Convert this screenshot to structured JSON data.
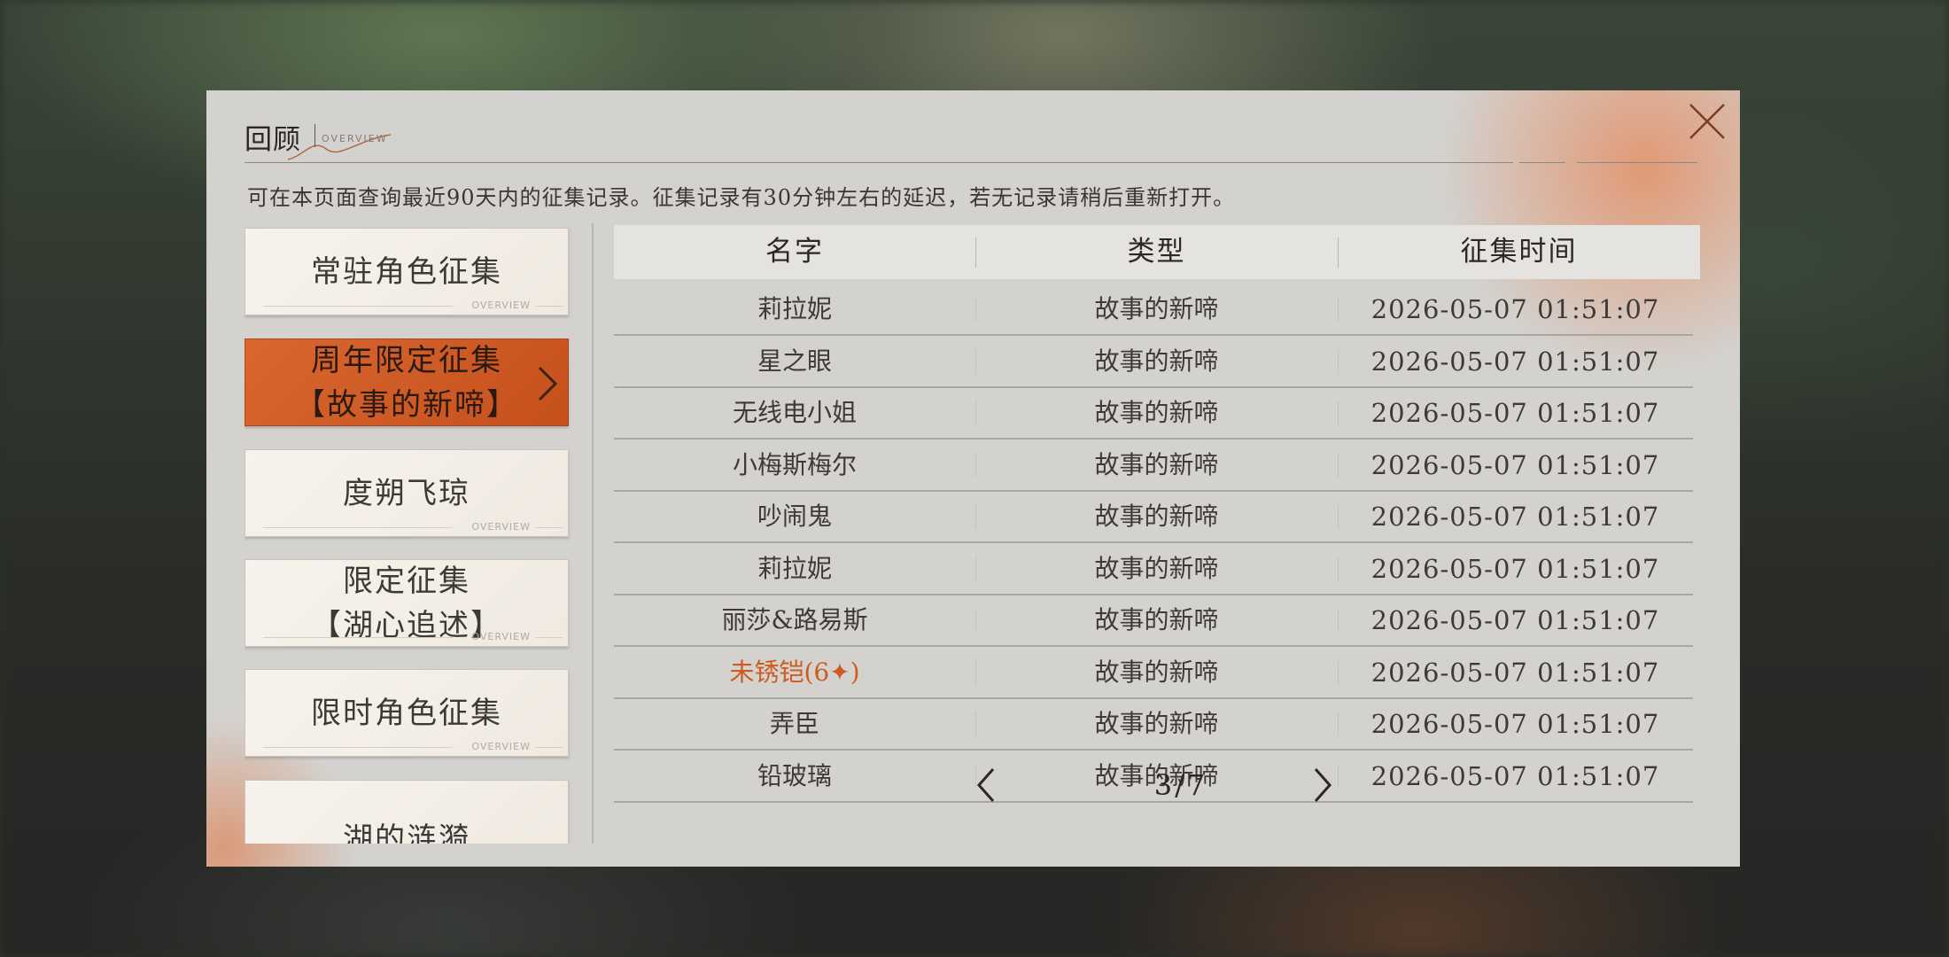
{
  "header": {
    "title": "回顾",
    "subtitle": "OVERVIEW",
    "notice": "可在本页面查询最近90天内的征集记录。征集记录有30分钟左右的延迟，若无记录请稍后重新打开。"
  },
  "colors": {
    "accent": "#cf5a1e",
    "panel": "#d3d2cf"
  },
  "sidebar": {
    "items": [
      {
        "label": "常驻角色征集",
        "ov": "OVERVIEW"
      },
      {
        "label": "周年限定征集\n【故事的新啼】",
        "active": true
      },
      {
        "label": "度朔飞琼",
        "ov": "OVERVIEW"
      },
      {
        "label": "限定征集\n【湖心追述】",
        "ov": "OVERVIEW"
      },
      {
        "label": "限时角色征集",
        "ov": "OVERVIEW"
      },
      {
        "label": "湖的涟漪"
      }
    ]
  },
  "table": {
    "headers": [
      "名字",
      "类型",
      "征集时间"
    ],
    "rows": [
      {
        "name": "莉拉妮",
        "type": "故事的新啼",
        "time": "2026-05-07 01:51:07"
      },
      {
        "name": "星之眼",
        "type": "故事的新啼",
        "time": "2026-05-07 01:51:07"
      },
      {
        "name": "无线电小姐",
        "type": "故事的新啼",
        "time": "2026-05-07 01:51:07"
      },
      {
        "name": "小梅斯梅尔",
        "type": "故事的新啼",
        "time": "2026-05-07 01:51:07"
      },
      {
        "name": "吵闹鬼",
        "type": "故事的新啼",
        "time": "2026-05-07 01:51:07"
      },
      {
        "name": "莉拉妮",
        "type": "故事的新啼",
        "time": "2026-05-07 01:51:07"
      },
      {
        "name": "丽莎&路易斯",
        "type": "故事的新啼",
        "time": "2026-05-07 01:51:07"
      },
      {
        "name": "未锈铠(6✦)",
        "type": "故事的新啼",
        "time": "2026-05-07 01:51:07",
        "highlight": true
      },
      {
        "name": "弄臣",
        "type": "故事的新啼",
        "time": "2026-05-07 01:51:07"
      },
      {
        "name": "铅玻璃",
        "type": "故事的新啼",
        "time": "2026-05-07 01:51:07"
      }
    ]
  },
  "pager": {
    "text": "3/7",
    "current": 3,
    "total": 7
  },
  "icons": {
    "close": "close-icon",
    "prev": "chevron-left-icon",
    "next": "chevron-right-icon",
    "active_arrow": "chevron-right-icon"
  }
}
